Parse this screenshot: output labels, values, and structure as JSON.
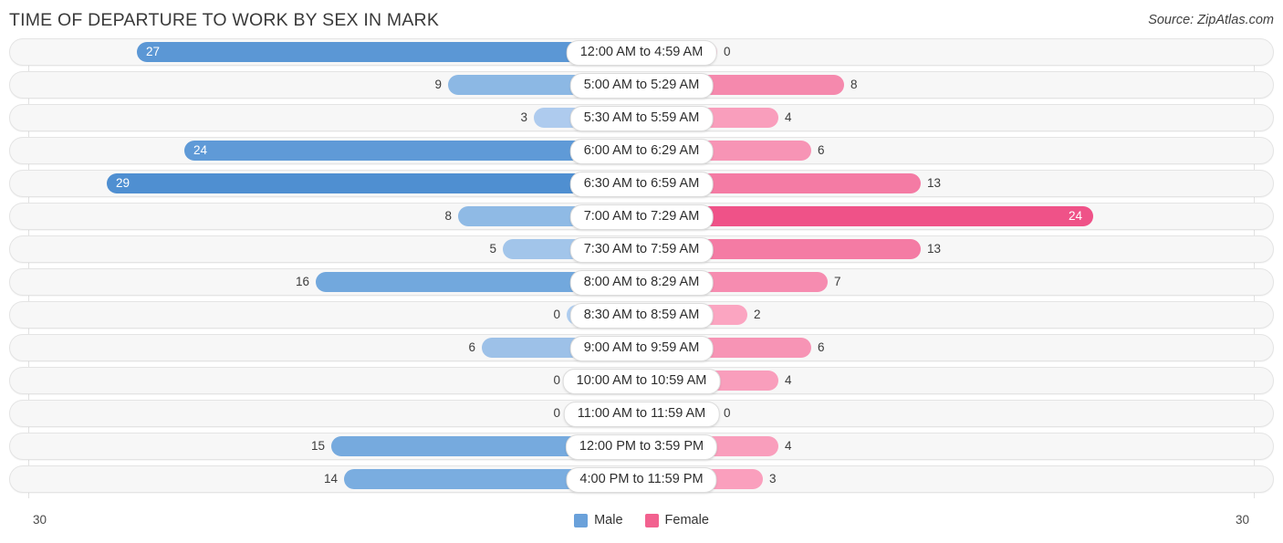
{
  "header": {
    "title": "TIME OF DEPARTURE TO WORK BY SEX IN MARK",
    "source": "Source: ZipAtlas.com"
  },
  "footer": {
    "axis_left": "30",
    "axis_right": "30",
    "legend": [
      {
        "label": "Male",
        "color": "#6aa1da"
      },
      {
        "label": "Female",
        "color": "#f2618f"
      }
    ]
  },
  "chart_data": {
    "type": "bar",
    "orientation": "diverging-horizontal",
    "title": "TIME OF DEPARTURE TO WORK BY SEX IN MARK",
    "xlabel": "",
    "ylabel": "",
    "axis_max": 30,
    "grid": false,
    "legend_position": "bottom-center",
    "categories": [
      "12:00 AM to 4:59 AM",
      "5:00 AM to 5:29 AM",
      "5:30 AM to 5:59 AM",
      "6:00 AM to 6:29 AM",
      "6:30 AM to 6:59 AM",
      "7:00 AM to 7:29 AM",
      "7:30 AM to 7:59 AM",
      "8:00 AM to 8:29 AM",
      "8:30 AM to 8:59 AM",
      "9:00 AM to 9:59 AM",
      "10:00 AM to 10:59 AM",
      "11:00 AM to 11:59 AM",
      "12:00 PM to 3:59 PM",
      "4:00 PM to 11:59 PM"
    ],
    "series": [
      {
        "name": "Male",
        "side": "left",
        "values": [
          27,
          9,
          3,
          24,
          29,
          8,
          5,
          16,
          0,
          6,
          0,
          0,
          15,
          14
        ]
      },
      {
        "name": "Female",
        "side": "right",
        "values": [
          0,
          8,
          4,
          6,
          13,
          24,
          13,
          7,
          2,
          6,
          4,
          0,
          4,
          3
        ]
      }
    ]
  },
  "rows": [
    {
      "label": "12:00 AM to 4:59 AM",
      "male": "27",
      "male_w": 544,
      "male_color": "#5b97d5",
      "male_inside": true,
      "female": "0",
      "female_w": 74,
      "female_color": "#fbb4cb",
      "female_inside": false
    },
    {
      "label": "5:00 AM to 5:29 AM",
      "male": "9",
      "male_w": 203,
      "male_color": "#8cb8e4",
      "male_inside": false,
      "female": "8",
      "female_w": 213,
      "female_color": "#f589ad",
      "female_inside": false
    },
    {
      "label": "5:30 AM to 5:59 AM",
      "male": "3",
      "male_w": 109,
      "male_color": "#aecbee",
      "male_inside": false,
      "female": "4",
      "female_w": 141,
      "female_color": "#f99ebc",
      "female_inside": false
    },
    {
      "label": "6:00 AM to 6:29 AM",
      "male": "24",
      "male_w": 492,
      "male_color": "#5f9ad7",
      "male_inside": true,
      "female": "6",
      "female_w": 177,
      "female_color": "#f794b5",
      "female_inside": false
    },
    {
      "label": "6:30 AM to 6:59 AM",
      "male": "29",
      "male_w": 577,
      "male_color": "#4f8fd1",
      "male_inside": true,
      "female": "13",
      "female_w": 297,
      "female_color": "#f47ba4",
      "female_inside": false
    },
    {
      "label": "7:00 AM to 7:29 AM",
      "male": "8",
      "male_w": 192,
      "male_color": "#8fbae5",
      "male_inside": false,
      "female": "24",
      "female_w": 486,
      "female_color": "#ef5288",
      "female_inside": true
    },
    {
      "label": "7:30 AM to 7:59 AM",
      "male": "5",
      "male_w": 143,
      "male_color": "#a2c5ea",
      "male_inside": false,
      "female": "13",
      "female_w": 297,
      "female_color": "#f47ba4",
      "female_inside": false
    },
    {
      "label": "8:00 AM to 8:29 AM",
      "male": "16",
      "male_w": 348,
      "male_color": "#72a8dd",
      "male_inside": false,
      "female": "7",
      "female_w": 195,
      "female_color": "#f68cb0",
      "female_inside": false
    },
    {
      "label": "8:30 AM to 8:59 AM",
      "male": "0",
      "male_w": 73,
      "male_color": "#aecdf0",
      "male_inside": false,
      "female": "2",
      "female_w": 107,
      "female_color": "#fba5c1",
      "female_inside": false
    },
    {
      "label": "9:00 AM to 9:59 AM",
      "male": "6",
      "male_w": 166,
      "male_color": "#9dc1e8",
      "male_inside": false,
      "female": "6",
      "female_w": 177,
      "female_color": "#f794b5",
      "female_inside": false
    },
    {
      "label": "10:00 AM to 10:59 AM",
      "male": "0",
      "male_w": 73,
      "male_color": "#aecdf0",
      "male_inside": false,
      "female": "4",
      "female_w": 141,
      "female_color": "#f99ebc",
      "female_inside": false
    },
    {
      "label": "11:00 AM to 11:59 AM",
      "male": "0",
      "male_w": 73,
      "male_color": "#aecdf0",
      "male_inside": false,
      "female": "0",
      "female_w": 74,
      "female_color": "#fbb4cb",
      "female_inside": false
    },
    {
      "label": "12:00 PM to 3:59 PM",
      "male": "15",
      "male_w": 331,
      "male_color": "#76aade",
      "male_inside": false,
      "female": "4",
      "female_w": 141,
      "female_color": "#f99ebc",
      "female_inside": false
    },
    {
      "label": "4:00 PM to 11:59 PM",
      "male": "14",
      "male_w": 317,
      "male_color": "#7aade0",
      "male_inside": false,
      "female": "3",
      "female_w": 124,
      "female_color": "#fa9fbd",
      "female_inside": false
    }
  ]
}
